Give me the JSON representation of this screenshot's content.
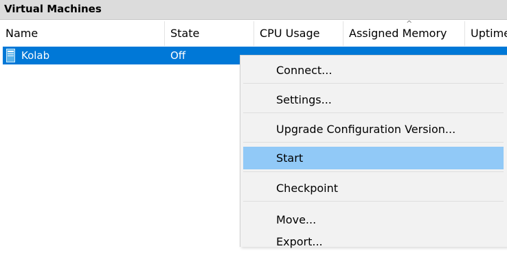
{
  "panel": {
    "title": "Virtual Machines"
  },
  "columns": [
    {
      "label": "Name"
    },
    {
      "label": "State"
    },
    {
      "label": "CPU Usage"
    },
    {
      "label": "Assigned Memory"
    },
    {
      "label": "Uptime"
    }
  ],
  "sort_indicator": "^",
  "vms": [
    {
      "name": "Kolab",
      "state": "Off"
    }
  ],
  "context_menu": {
    "items": [
      {
        "label": "Connect..."
      },
      {
        "label": "Settings..."
      },
      {
        "label": "Upgrade Configuration Version..."
      },
      {
        "label": "Start",
        "highlighted": true
      },
      {
        "label": "Checkpoint"
      },
      {
        "label": "Move..."
      },
      {
        "label": "Export..."
      }
    ]
  },
  "colors": {
    "selection": "#0078d7",
    "menu_highlight": "#91c9f7",
    "header_bg": "#dcdcdc",
    "menu_bg": "#f2f2f2"
  }
}
